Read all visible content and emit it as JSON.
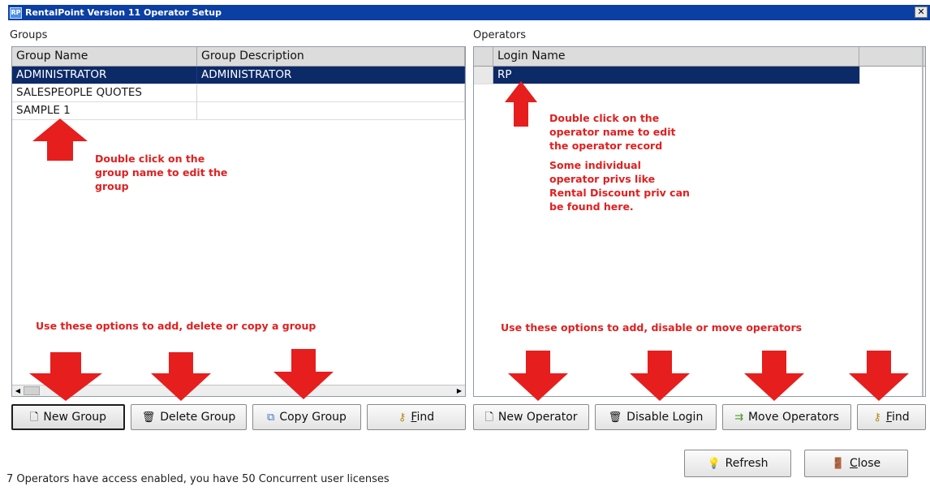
{
  "window": {
    "icon_text": "RP",
    "title": "RentalPoint Version 11 Operator Setup",
    "close_glyph": "✕"
  },
  "groups": {
    "label": "Groups",
    "columns": [
      "Group Name",
      "Group Description"
    ],
    "rows": [
      {
        "name": "ADMINISTRATOR",
        "description": "ADMINISTRATOR"
      },
      {
        "name": "SALESPEOPLE QUOTES",
        "description": ""
      },
      {
        "name": "SAMPLE 1",
        "description": ""
      }
    ],
    "selected_row": 0,
    "buttons": {
      "new": "New Group",
      "delete": "Delete Group",
      "copy": "Copy Group",
      "find_prefix": "",
      "find_underlined": "F",
      "find_rest": "ind"
    }
  },
  "operators": {
    "label": "Operators",
    "columns": [
      "Login Name"
    ],
    "rows": [
      {
        "login": "RP"
      }
    ],
    "selected_row": 0,
    "buttons": {
      "new": "New Operator",
      "disable": "Disable Login",
      "move": "Move Operators",
      "find_underlined": "F",
      "find_rest": "ind"
    }
  },
  "footer": {
    "refresh": "Refresh",
    "close_underlined": "C",
    "close_rest": "lose",
    "status": "7 Operators have access enabled,  you have 50 Concurrent user licenses"
  },
  "annotations": {
    "group_edit": [
      "Double click on the",
      "group name to edit the",
      "group"
    ],
    "operator_edit": [
      "Double click on the",
      "operator name to edit",
      "the operator record"
    ],
    "operator_privs": [
      "Some individual",
      "operator privs like",
      "Rental Discount priv can",
      "be found here."
    ],
    "group_options": "Use these options to add, delete or copy a group",
    "operator_options": "Use these options to add, disable or move operators"
  },
  "icons": {
    "new": "page-icon",
    "delete": "trash-icon",
    "copy": "copy-icon",
    "find": "key-find-icon",
    "move": "move-icon",
    "refresh": "lightbulb-icon",
    "close": "door-icon"
  },
  "colors": {
    "title_bar": "#0b3fa4",
    "selection": "#0c2a68",
    "annotation": "#e02020"
  }
}
